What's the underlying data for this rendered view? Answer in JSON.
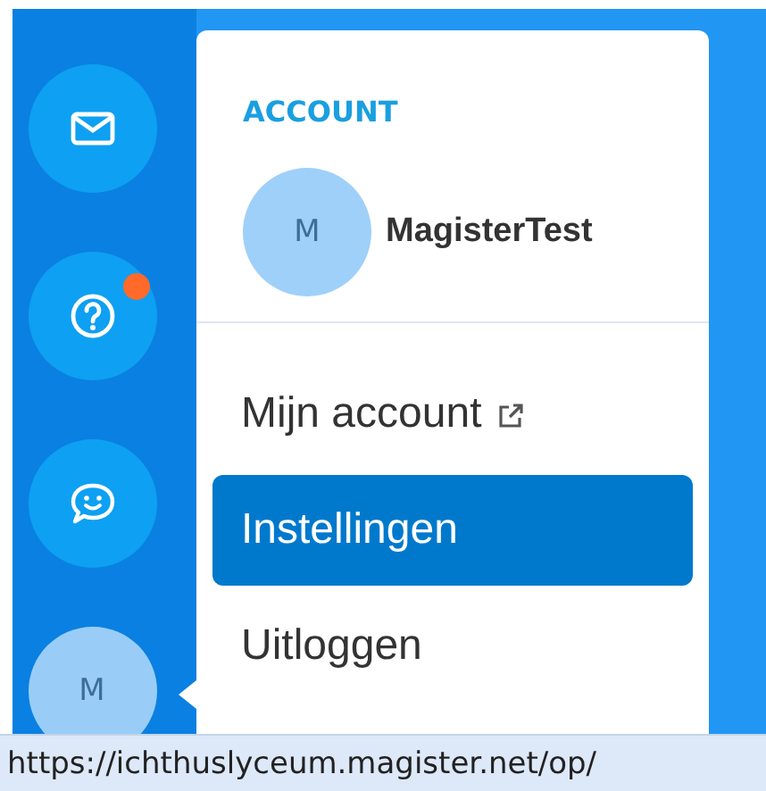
{
  "sidebar": {
    "items": [
      {
        "kind": "mail",
        "notification": false
      },
      {
        "kind": "help",
        "notification": true
      },
      {
        "kind": "chat",
        "notification": false
      },
      {
        "kind": "avatar",
        "initial": "M",
        "notification": false
      }
    ]
  },
  "menu": {
    "header": "ACCOUNT",
    "user": {
      "initial": "M",
      "name": "MagisterTest"
    },
    "items": [
      {
        "label": "Mijn account",
        "external": true,
        "selected": false
      },
      {
        "label": "Instellingen",
        "external": false,
        "selected": true
      },
      {
        "label": "Uitloggen",
        "external": false,
        "selected": false
      }
    ]
  },
  "status_bar": {
    "url": "https://ichthuslyceum.magister.net/op/"
  }
}
